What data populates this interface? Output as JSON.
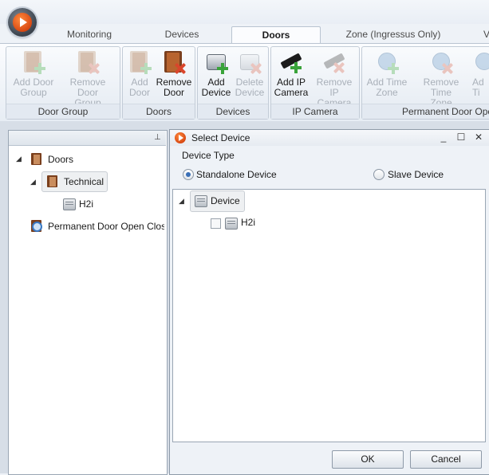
{
  "tabs": [
    {
      "label": "Monitoring",
      "active": false
    },
    {
      "label": "Devices",
      "active": false
    },
    {
      "label": "Doors",
      "active": true
    },
    {
      "label": "Zone (Ingressus Only)",
      "active": false
    },
    {
      "label": "V",
      "active": false
    }
  ],
  "ribbon": {
    "groups": [
      {
        "label": "Door Group",
        "buttons": [
          {
            "label": "Add Door\nGroup",
            "enabled": false,
            "icon": "add-door-group-icon"
          },
          {
            "label": "Remove Door\nGroup",
            "enabled": false,
            "icon": "remove-door-group-icon"
          }
        ]
      },
      {
        "label": "Doors",
        "buttons": [
          {
            "label": "Add\nDoor",
            "enabled": false,
            "icon": "add-door-icon"
          },
          {
            "label": "Remove\nDoor",
            "enabled": true,
            "icon": "remove-door-icon"
          }
        ]
      },
      {
        "label": "Devices",
        "buttons": [
          {
            "label": "Add\nDevice",
            "enabled": true,
            "icon": "add-device-icon"
          },
          {
            "label": "Delete\nDevice",
            "enabled": false,
            "icon": "delete-device-icon"
          }
        ]
      },
      {
        "label": "IP Camera",
        "buttons": [
          {
            "label": "Add IP\nCamera",
            "enabled": true,
            "icon": "add-ip-camera-icon"
          },
          {
            "label": "Remove IP\nCamera",
            "enabled": false,
            "icon": "remove-ip-camera-icon"
          }
        ]
      },
      {
        "label": "Permanent Door Ope",
        "buttons": [
          {
            "label": "Add Time\nZone",
            "enabled": false,
            "icon": "add-time-zone-icon"
          },
          {
            "label": "Remove Time\nZone",
            "enabled": false,
            "icon": "remove-time-zone-icon"
          },
          {
            "label": "Ad\nTi",
            "enabled": false,
            "icon": "add-icon"
          }
        ]
      }
    ]
  },
  "left_tree": {
    "pin_glyph": "⊥",
    "nodes": [
      {
        "label": "Doors",
        "icon": "door-group-icon",
        "expanded": true
      },
      {
        "label": "Technical",
        "icon": "door-icon",
        "expanded": true,
        "selected": true
      },
      {
        "label": "H2i",
        "icon": "device-icon"
      },
      {
        "label": "Permanent Door Open Clos",
        "icon": "search-door-icon"
      }
    ]
  },
  "dialog": {
    "title": "Select Device",
    "controls": {
      "minimize": "_",
      "maximize": "☐",
      "close": "✕"
    },
    "device_type_label": "Device Type",
    "options": [
      {
        "label": "Standalone Device",
        "selected": true
      },
      {
        "label": "Slave Device",
        "selected": false
      }
    ],
    "tree": {
      "root": {
        "label": "Device",
        "expanded": true
      },
      "children": [
        {
          "label": "H2i",
          "checked": false
        }
      ]
    },
    "ok_label": "OK",
    "cancel_label": "Cancel"
  },
  "colors": {
    "accent_orange": "#e0531a",
    "door_brown": "#a85a2e",
    "add_green": "#39a33a",
    "remove_red": "#d9452b"
  }
}
